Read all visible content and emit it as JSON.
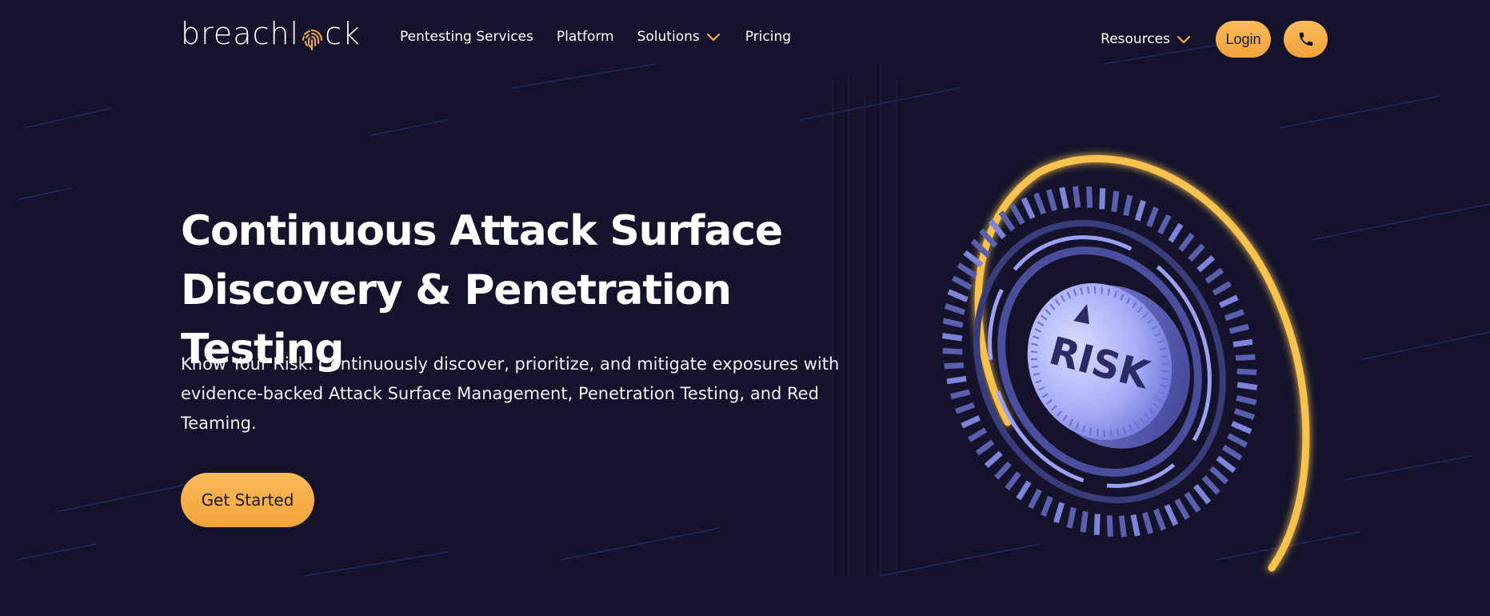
{
  "brand": {
    "logo_text_pre": "breachl",
    "logo_text_post": "ck"
  },
  "nav": {
    "links": [
      {
        "label": "Pentesting Services",
        "has_dropdown": false
      },
      {
        "label": "Platform",
        "has_dropdown": false
      },
      {
        "label": "Solutions",
        "has_dropdown": true
      },
      {
        "label": "Pricing",
        "has_dropdown": false
      }
    ],
    "resources_label": "Resources",
    "login_label": "Login",
    "phone_icon": "phone-icon"
  },
  "hero": {
    "title_line1": "Continuous Attack Surface",
    "title_line2": "Discovery & Penetration Testing",
    "subtitle": "Know Your Risk. Continuously discover, prioritize, and mitigate exposures with evidence-backed Attack Surface Management, Penetration Testing, and Red Teaming.",
    "cta_label": "Get Started"
  },
  "illustration": {
    "dial_text": "RISK"
  },
  "colors": {
    "background": "#14132b",
    "accent": "#f6ad45",
    "dial_periwinkle": "#8f95e8",
    "text": "#ffffff"
  }
}
